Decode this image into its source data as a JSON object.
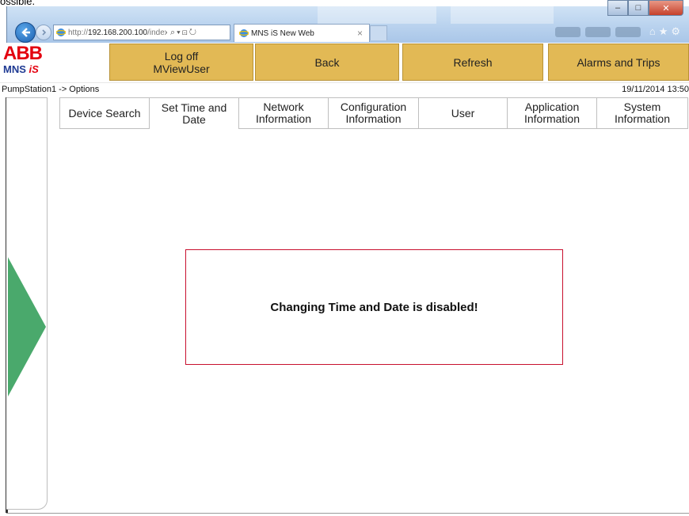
{
  "top_text": "ossible.",
  "browser": {
    "url_prefix": "http://",
    "url_host": "192.168.200.100",
    "url_path": "/index.p",
    "tab_title": "MNS iS New Web"
  },
  "header": {
    "logo_top": "ABB",
    "logo_bottom_a": "MNS ",
    "logo_bottom_b": "iS",
    "buttons": {
      "logoff": "Log off",
      "logoff_user": "MViewUser",
      "back": "Back",
      "refresh": "Refresh",
      "alarms": "Alarms and Trips"
    },
    "button_color": "#e2b955"
  },
  "breadcrumb": "PumpStation1 -> Options",
  "datetime": "19/11/2014 13:50",
  "tabs": [
    {
      "l1": "Device Search",
      "l2": ""
    },
    {
      "l1": "Set Time and",
      "l2": "Date"
    },
    {
      "l1": "Network",
      "l2": "Information"
    },
    {
      "l1": "Configuration",
      "l2": "Information"
    },
    {
      "l1": "User",
      "l2": ""
    },
    {
      "l1": "Application",
      "l2": "Information"
    },
    {
      "l1": "System",
      "l2": "Information"
    }
  ],
  "active_tab": "Set Time and Date",
  "message": "Changing Time and Date is disabled!",
  "colors": {
    "accent_green": "#4aa96c",
    "message_border": "#c8102e"
  }
}
